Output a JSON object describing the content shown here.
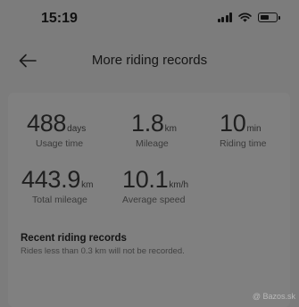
{
  "status_bar": {
    "time": "15:19",
    "icons": [
      "cellular-signal-icon",
      "wifi-icon",
      "battery-icon"
    ]
  },
  "nav": {
    "back_icon": "arrow-left-icon",
    "title": "More riding records"
  },
  "stats": {
    "usage_time": {
      "value": "488",
      "unit": "days",
      "label": "Usage time"
    },
    "mileage": {
      "value": "1.8",
      "unit": "km",
      "label": "Mileage"
    },
    "riding_time": {
      "value": "10",
      "unit": "min",
      "label": "Riding time"
    },
    "total_mileage": {
      "value": "443.9",
      "unit": "km",
      "label": "Total mileage"
    },
    "average_speed": {
      "value": "10.1",
      "unit": "km/h",
      "label": "Average speed"
    }
  },
  "recent": {
    "title": "Recent riding records",
    "subtitle": "Rides less than 0.3 km will not be recorded."
  },
  "watermark": "@ Bazos.sk",
  "colors": {
    "background": "#7c7c7c",
    "card": "#808080",
    "text_primary": "#1f1f1f",
    "text_secondary": "#3a3a3a"
  }
}
